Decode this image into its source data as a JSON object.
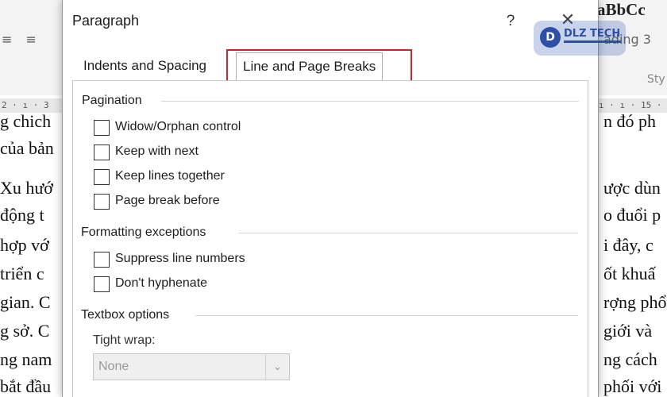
{
  "dialog": {
    "title": "Paragraph",
    "help_label": "?",
    "close_label": "✕"
  },
  "tabs": [
    {
      "label": "Indents and Spacing",
      "active": false
    },
    {
      "label": "Line and Page Breaks",
      "active": true
    }
  ],
  "pagination": {
    "title": "Pagination",
    "options": [
      {
        "label": "Widow/Orphan control",
        "checked": false
      },
      {
        "label": "Keep with next",
        "checked": false
      },
      {
        "label": "Keep lines together",
        "checked": false
      },
      {
        "label": "Page break before",
        "checked": false
      }
    ]
  },
  "formatting": {
    "title": "Formatting exceptions",
    "options": [
      {
        "label": "Suppress line numbers",
        "checked": false
      },
      {
        "label": "Don't hyphenate",
        "checked": false
      }
    ]
  },
  "textbox": {
    "title": "Textbox options",
    "tight_wrap_label": "Tight wrap:",
    "tight_wrap_value": "None"
  },
  "background": {
    "style_preview": "aBbCc",
    "style_heading": "ading 3",
    "style_label": "Sty",
    "ruler_left": "2 · ı · 3",
    "ruler_right": "ı · ı · 15 ·",
    "left_lines": [
      "g chich",
      "của bản",
      "Xu hướ",
      "động t",
      "hợp vớ",
      "triển c",
      "gian. C",
      "g sở. C",
      "ng nam",
      "bắt đầu"
    ],
    "right_lines": [
      "n đó ph",
      "ược dùn",
      "o đuổi p",
      "i đây, c",
      "ốt khuấ",
      "rợng phổ",
      "giới và",
      "ng cách",
      "phối với",
      ""
    ]
  },
  "logo": {
    "mark": "D",
    "text": "DLZ TECH"
  },
  "colors": {
    "highlight": "#c3262c",
    "logo_brand": "#2d4fa6"
  }
}
